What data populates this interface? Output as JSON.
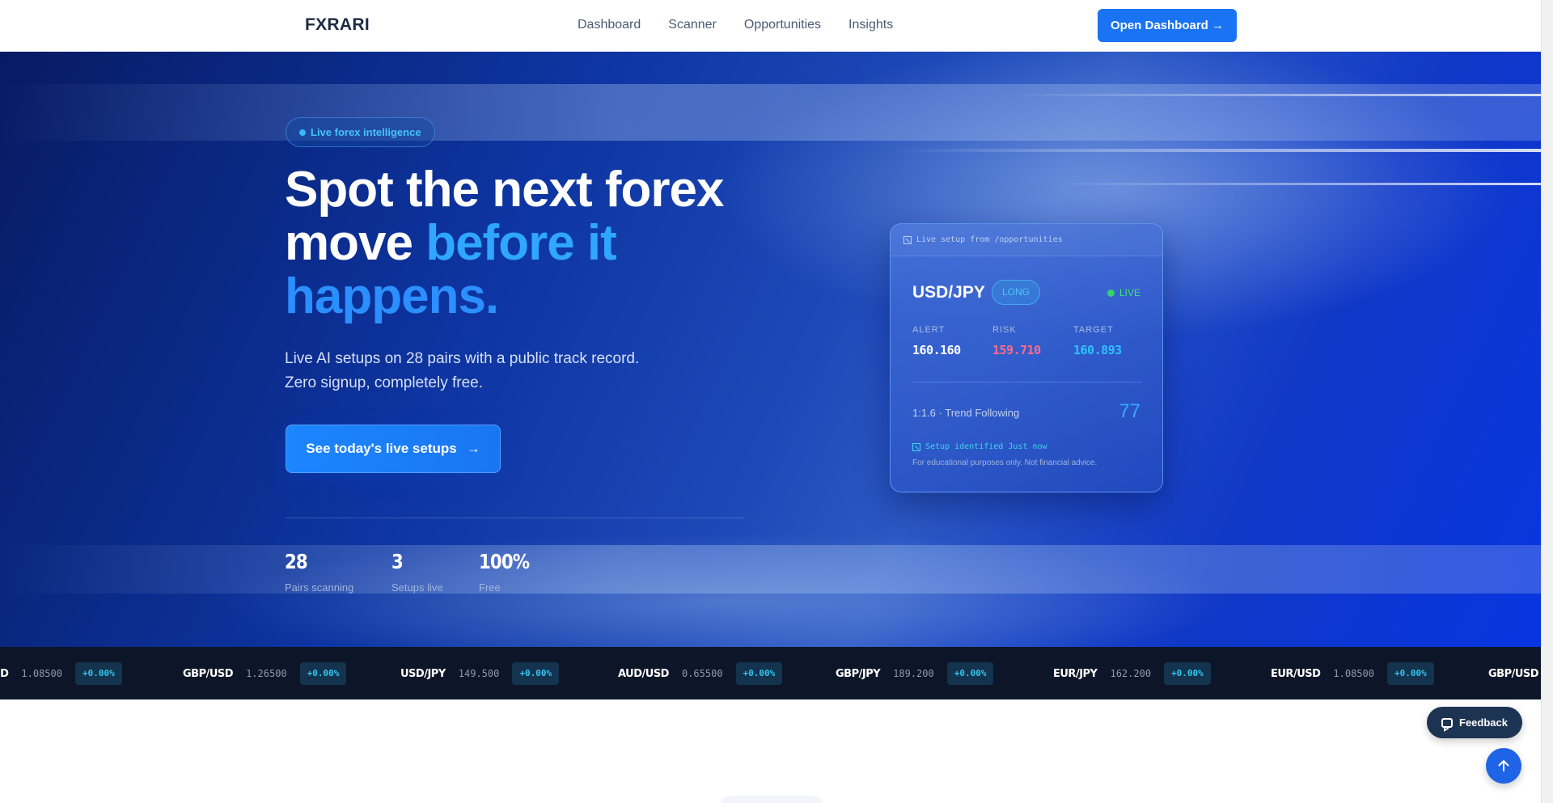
{
  "header": {
    "logo": "FXRARI",
    "nav": [
      "Dashboard",
      "Scanner",
      "Opportunities",
      "Insights"
    ],
    "cta": "Open Dashboard →"
  },
  "hero": {
    "badge": "Live forex intelligence",
    "headline_line1": "Spot the next forex",
    "headline_move": "move ",
    "headline_accent1": "before it",
    "headline_accent2": "happens.",
    "sub_line1": "Live AI setups on 28 pairs with a public track record.",
    "sub_line2": "Zero signup, completely free.",
    "cta": "See today's live setups",
    "cta_arrow": "→",
    "stats": [
      {
        "value": "28",
        "label": "Pairs scanning"
      },
      {
        "value": "3",
        "label": "Setups live"
      },
      {
        "value": "100%",
        "label": "Free"
      }
    ]
  },
  "card": {
    "header": "Live setup from /opportunities",
    "pair": "USD/JPY",
    "direction": "LONG",
    "status": "LIVE",
    "alert_label": "ALERT",
    "alert_value": "160.160",
    "risk_label": "RISK",
    "risk_value": "159.710",
    "target_label": "TARGET",
    "target_value": "160.893",
    "strategy": "1:1.6 · Trend Following",
    "score": "77",
    "identified": "Setup identified Just now",
    "disclaimer": "For educational purposes only. Not financial advice."
  },
  "ticker": [
    {
      "pair": "EUR/USD",
      "price": "1.08500",
      "change": "+0.00%"
    },
    {
      "pair": "GBP/USD",
      "price": "1.26500",
      "change": "+0.00%"
    },
    {
      "pair": "USD/JPY",
      "price": "149.500",
      "change": "+0.00%"
    },
    {
      "pair": "AUD/USD",
      "price": "0.65500",
      "change": "+0.00%"
    },
    {
      "pair": "GBP/JPY",
      "price": "189.200",
      "change": "+0.00%"
    },
    {
      "pair": "EUR/JPY",
      "price": "162.200",
      "change": "+0.00%"
    },
    {
      "pair": "EUR/USD",
      "price": "1.08500",
      "change": "+0.00%"
    },
    {
      "pair": "GBP/USD",
      "price": "",
      "change": ""
    }
  ],
  "floating": {
    "feedback": "Feedback"
  },
  "colors": {
    "accent": "#1a73f3",
    "headline_accent": "#2fa6ff",
    "risk": "#ff6b8a",
    "target": "#2fc3ff",
    "live": "#34d26c",
    "ticker_bg": "#0c1628"
  },
  "icons": {
    "card_header": "chart-icon",
    "identified": "chart-icon",
    "feedback": "chat-icon",
    "to_top": "arrow-up-icon"
  }
}
